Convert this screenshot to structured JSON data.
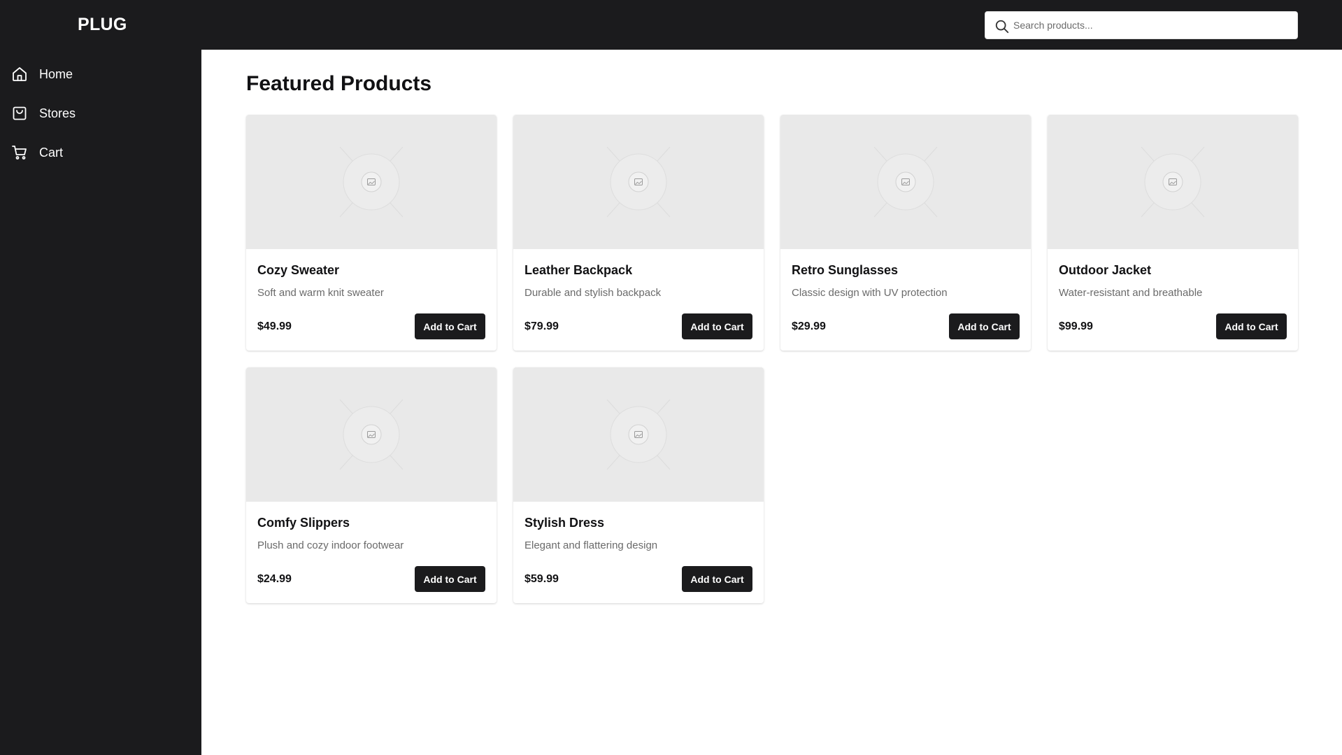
{
  "app": {
    "logo": "PLUG"
  },
  "search": {
    "placeholder": "Search products..."
  },
  "sidebar": {
    "items": [
      {
        "label": "Home",
        "icon": "home-icon"
      },
      {
        "label": "Stores",
        "icon": "shopping-bag-icon"
      },
      {
        "label": "Cart",
        "icon": "cart-icon"
      }
    ]
  },
  "main": {
    "title": "Featured Products"
  },
  "products": [
    {
      "name": "Cozy Sweater",
      "description": "Soft and warm knit sweater",
      "price": "$49.99",
      "button": "Add to Cart"
    },
    {
      "name": "Leather Backpack",
      "description": "Durable and stylish backpack",
      "price": "$79.99",
      "button": "Add to Cart"
    },
    {
      "name": "Retro Sunglasses",
      "description": "Classic design with UV protection",
      "price": "$29.99",
      "button": "Add to Cart"
    },
    {
      "name": "Outdoor Jacket",
      "description": "Water-resistant and breathable",
      "price": "$99.99",
      "button": "Add to Cart"
    },
    {
      "name": "Comfy Slippers",
      "description": "Plush and cozy indoor footwear",
      "price": "$24.99",
      "button": "Add to Cart"
    },
    {
      "name": "Stylish Dress",
      "description": "Elegant and flattering design",
      "price": "$59.99",
      "button": "Add to Cart"
    }
  ],
  "colors": {
    "dark": "#1b1b1d",
    "placeholder_bg": "#e9e9e9",
    "muted_text": "#6a6a6a"
  }
}
